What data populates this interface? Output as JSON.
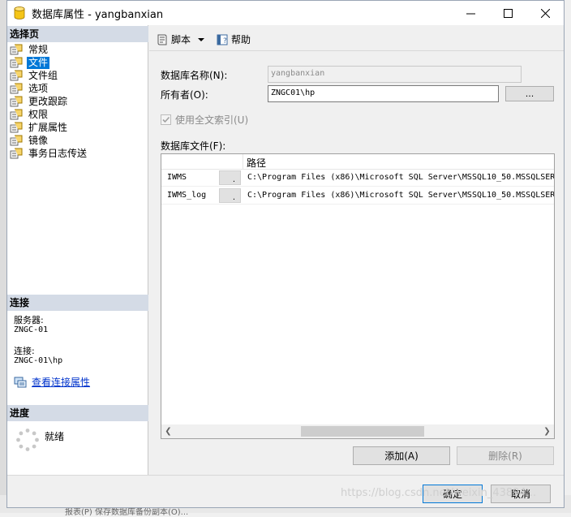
{
  "window": {
    "title": "数据库属性 - yangbanxian"
  },
  "sidebar": {
    "select_page_header": "选择页",
    "items": [
      {
        "label": "常规",
        "selected": false
      },
      {
        "label": "文件",
        "selected": true
      },
      {
        "label": "文件组",
        "selected": false
      },
      {
        "label": "选项",
        "selected": false
      },
      {
        "label": "更改跟踪",
        "selected": false
      },
      {
        "label": "权限",
        "selected": false
      },
      {
        "label": "扩展属性",
        "selected": false
      },
      {
        "label": "镜像",
        "selected": false
      },
      {
        "label": "事务日志传送",
        "selected": false
      }
    ],
    "connection_header": "连接",
    "server_label": "服务器:",
    "server_value": "ZNGC-01",
    "connection_label": "连接:",
    "connection_value": "ZNGC-01\\hp",
    "view_connection_link": "查看连接属性",
    "progress_header": "进度",
    "progress_status": "就绪"
  },
  "toolbar": {
    "script_label": "脚本",
    "help_label": "帮助"
  },
  "form": {
    "db_name_label": "数据库名称(N):",
    "db_name_value": "yangbanxian",
    "owner_label": "所有者(O):",
    "owner_value": "ZNGC01\\hp",
    "owner_browse_label": "...",
    "fulltext_label": "使用全文索引(U)",
    "files_label": "数据库文件(F):"
  },
  "files_grid": {
    "columns": [
      "路径"
    ],
    "rows": [
      {
        "name": "IWMS",
        "ellipsis": ".",
        "path": "C:\\Program Files (x86)\\Microsoft SQL Server\\MSSQL10_50.MSSQLSER"
      },
      {
        "name": "IWMS_log",
        "ellipsis": ".",
        "path": "C:\\Program Files (x86)\\Microsoft SQL Server\\MSSQL10_50.MSSQLSER"
      }
    ]
  },
  "buttons": {
    "add": "添加(A)",
    "remove": "删除(R)",
    "ok": "确定",
    "cancel": "取消"
  },
  "background": {
    "bottom_text": "报表(P)   保存数据库备份副本(O)..."
  },
  "watermark": "https://blog.csdn.net/weixin_43894..."
}
